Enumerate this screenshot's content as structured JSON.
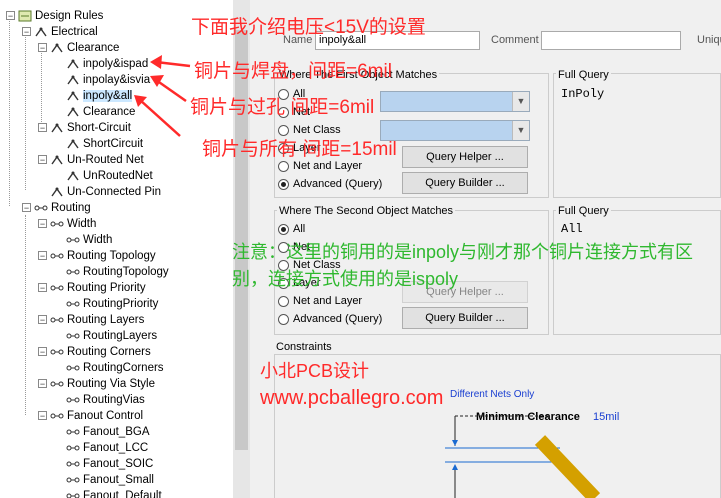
{
  "tree": {
    "items": [
      {
        "label": "Design Rules",
        "toggle": "-",
        "icon": "rules"
      },
      {
        "label": "Electrical",
        "toggle": "-",
        "icon": "folder"
      },
      {
        "label": "Clearance",
        "toggle": "-",
        "icon": "rule"
      },
      {
        "label": "inpoly&ispad",
        "toggle": "",
        "icon": "rule"
      },
      {
        "label": "inpolay&isvia",
        "toggle": "",
        "icon": "rule"
      },
      {
        "label": "inpoly&all",
        "toggle": "",
        "icon": "rule"
      },
      {
        "label": "Clearance",
        "toggle": "",
        "icon": "rule"
      },
      {
        "label": "Short-Circuit",
        "toggle": "-",
        "icon": "rule"
      },
      {
        "label": "ShortCircuit",
        "toggle": "",
        "icon": "rule"
      },
      {
        "label": "Un-Routed Net",
        "toggle": "-",
        "icon": "rule"
      },
      {
        "label": "UnRoutedNet",
        "toggle": "",
        "icon": "rule"
      },
      {
        "label": "Un-Connected Pin",
        "toggle": "",
        "icon": "rule"
      },
      {
        "label": "Routing",
        "toggle": "-",
        "icon": "route"
      },
      {
        "label": "Width",
        "toggle": "-",
        "icon": "route"
      },
      {
        "label": "Width",
        "toggle": "",
        "icon": "route"
      },
      {
        "label": "Routing Topology",
        "toggle": "-",
        "icon": "route"
      },
      {
        "label": "RoutingTopology",
        "toggle": "",
        "icon": "route"
      },
      {
        "label": "Routing Priority",
        "toggle": "-",
        "icon": "route"
      },
      {
        "label": "RoutingPriority",
        "toggle": "",
        "icon": "route"
      },
      {
        "label": "Routing Layers",
        "toggle": "-",
        "icon": "route"
      },
      {
        "label": "RoutingLayers",
        "toggle": "",
        "icon": "route"
      },
      {
        "label": "Routing Corners",
        "toggle": "-",
        "icon": "route"
      },
      {
        "label": "RoutingCorners",
        "toggle": "",
        "icon": "route"
      },
      {
        "label": "Routing Via Style",
        "toggle": "-",
        "icon": "route"
      },
      {
        "label": "RoutingVias",
        "toggle": "",
        "icon": "route"
      },
      {
        "label": "Fanout Control",
        "toggle": "-",
        "icon": "route"
      },
      {
        "label": "Fanout_BGA",
        "toggle": "",
        "icon": "route"
      },
      {
        "label": "Fanout_LCC",
        "toggle": "",
        "icon": "route"
      },
      {
        "label": "Fanout_SOIC",
        "toggle": "",
        "icon": "route"
      },
      {
        "label": "Fanout_Small",
        "toggle": "",
        "icon": "route"
      },
      {
        "label": "Fanout_Default",
        "toggle": "",
        "icon": "route"
      }
    ]
  },
  "header": {
    "name_label": "Name",
    "name_value": "inpoly&all",
    "comment_label": "Comment",
    "unique_label": "Uniqu"
  },
  "first": {
    "title": "Where The First Object Matches",
    "options": [
      "All",
      "Net",
      "Net Class",
      "Layer",
      "Net and Layer",
      "Advanced (Query)"
    ],
    "selected": "Advanced (Query)",
    "query_helper": "Query Helper ...",
    "query_builder": "Query Builder ...",
    "full_query_label": "Full Query",
    "full_query": "InPoly"
  },
  "second": {
    "title": "Where The Second Object Matches",
    "options": [
      "All",
      "Net",
      "Net Class",
      "Layer",
      "Net and Layer",
      "Advanced (Query)"
    ],
    "selected": "All",
    "query_helper": "Query Helper ...",
    "query_builder": "Query Builder ...",
    "full_query_label": "Full Query",
    "full_query": "All"
  },
  "constraints": {
    "label": "Constraints",
    "different_nets": "Different Nets Only",
    "min_clearance_label": "Minimum Clearance",
    "min_clearance_value": "15mil"
  },
  "annotations": {
    "top": "下面我介绍电压<15V的设置",
    "a1": "铜片与焊盘，间距=6mil",
    "a2": "铜片与过孔 间距=6mil",
    "a3": "铜片与所有 间距=15mil",
    "note": "注意：这里的铜用的是inpoly与刚才那个铜片连接方式有区别，连接方式使用的是ispoly",
    "brand": "小北PCB设计",
    "url": "www.pcballegro.com"
  },
  "colors": {
    "annotation_red": "#ff2a2a",
    "annotation_green": "#2fb82f",
    "combo_blue": "#b8d3ef",
    "accent_blue": "#0000cc"
  }
}
